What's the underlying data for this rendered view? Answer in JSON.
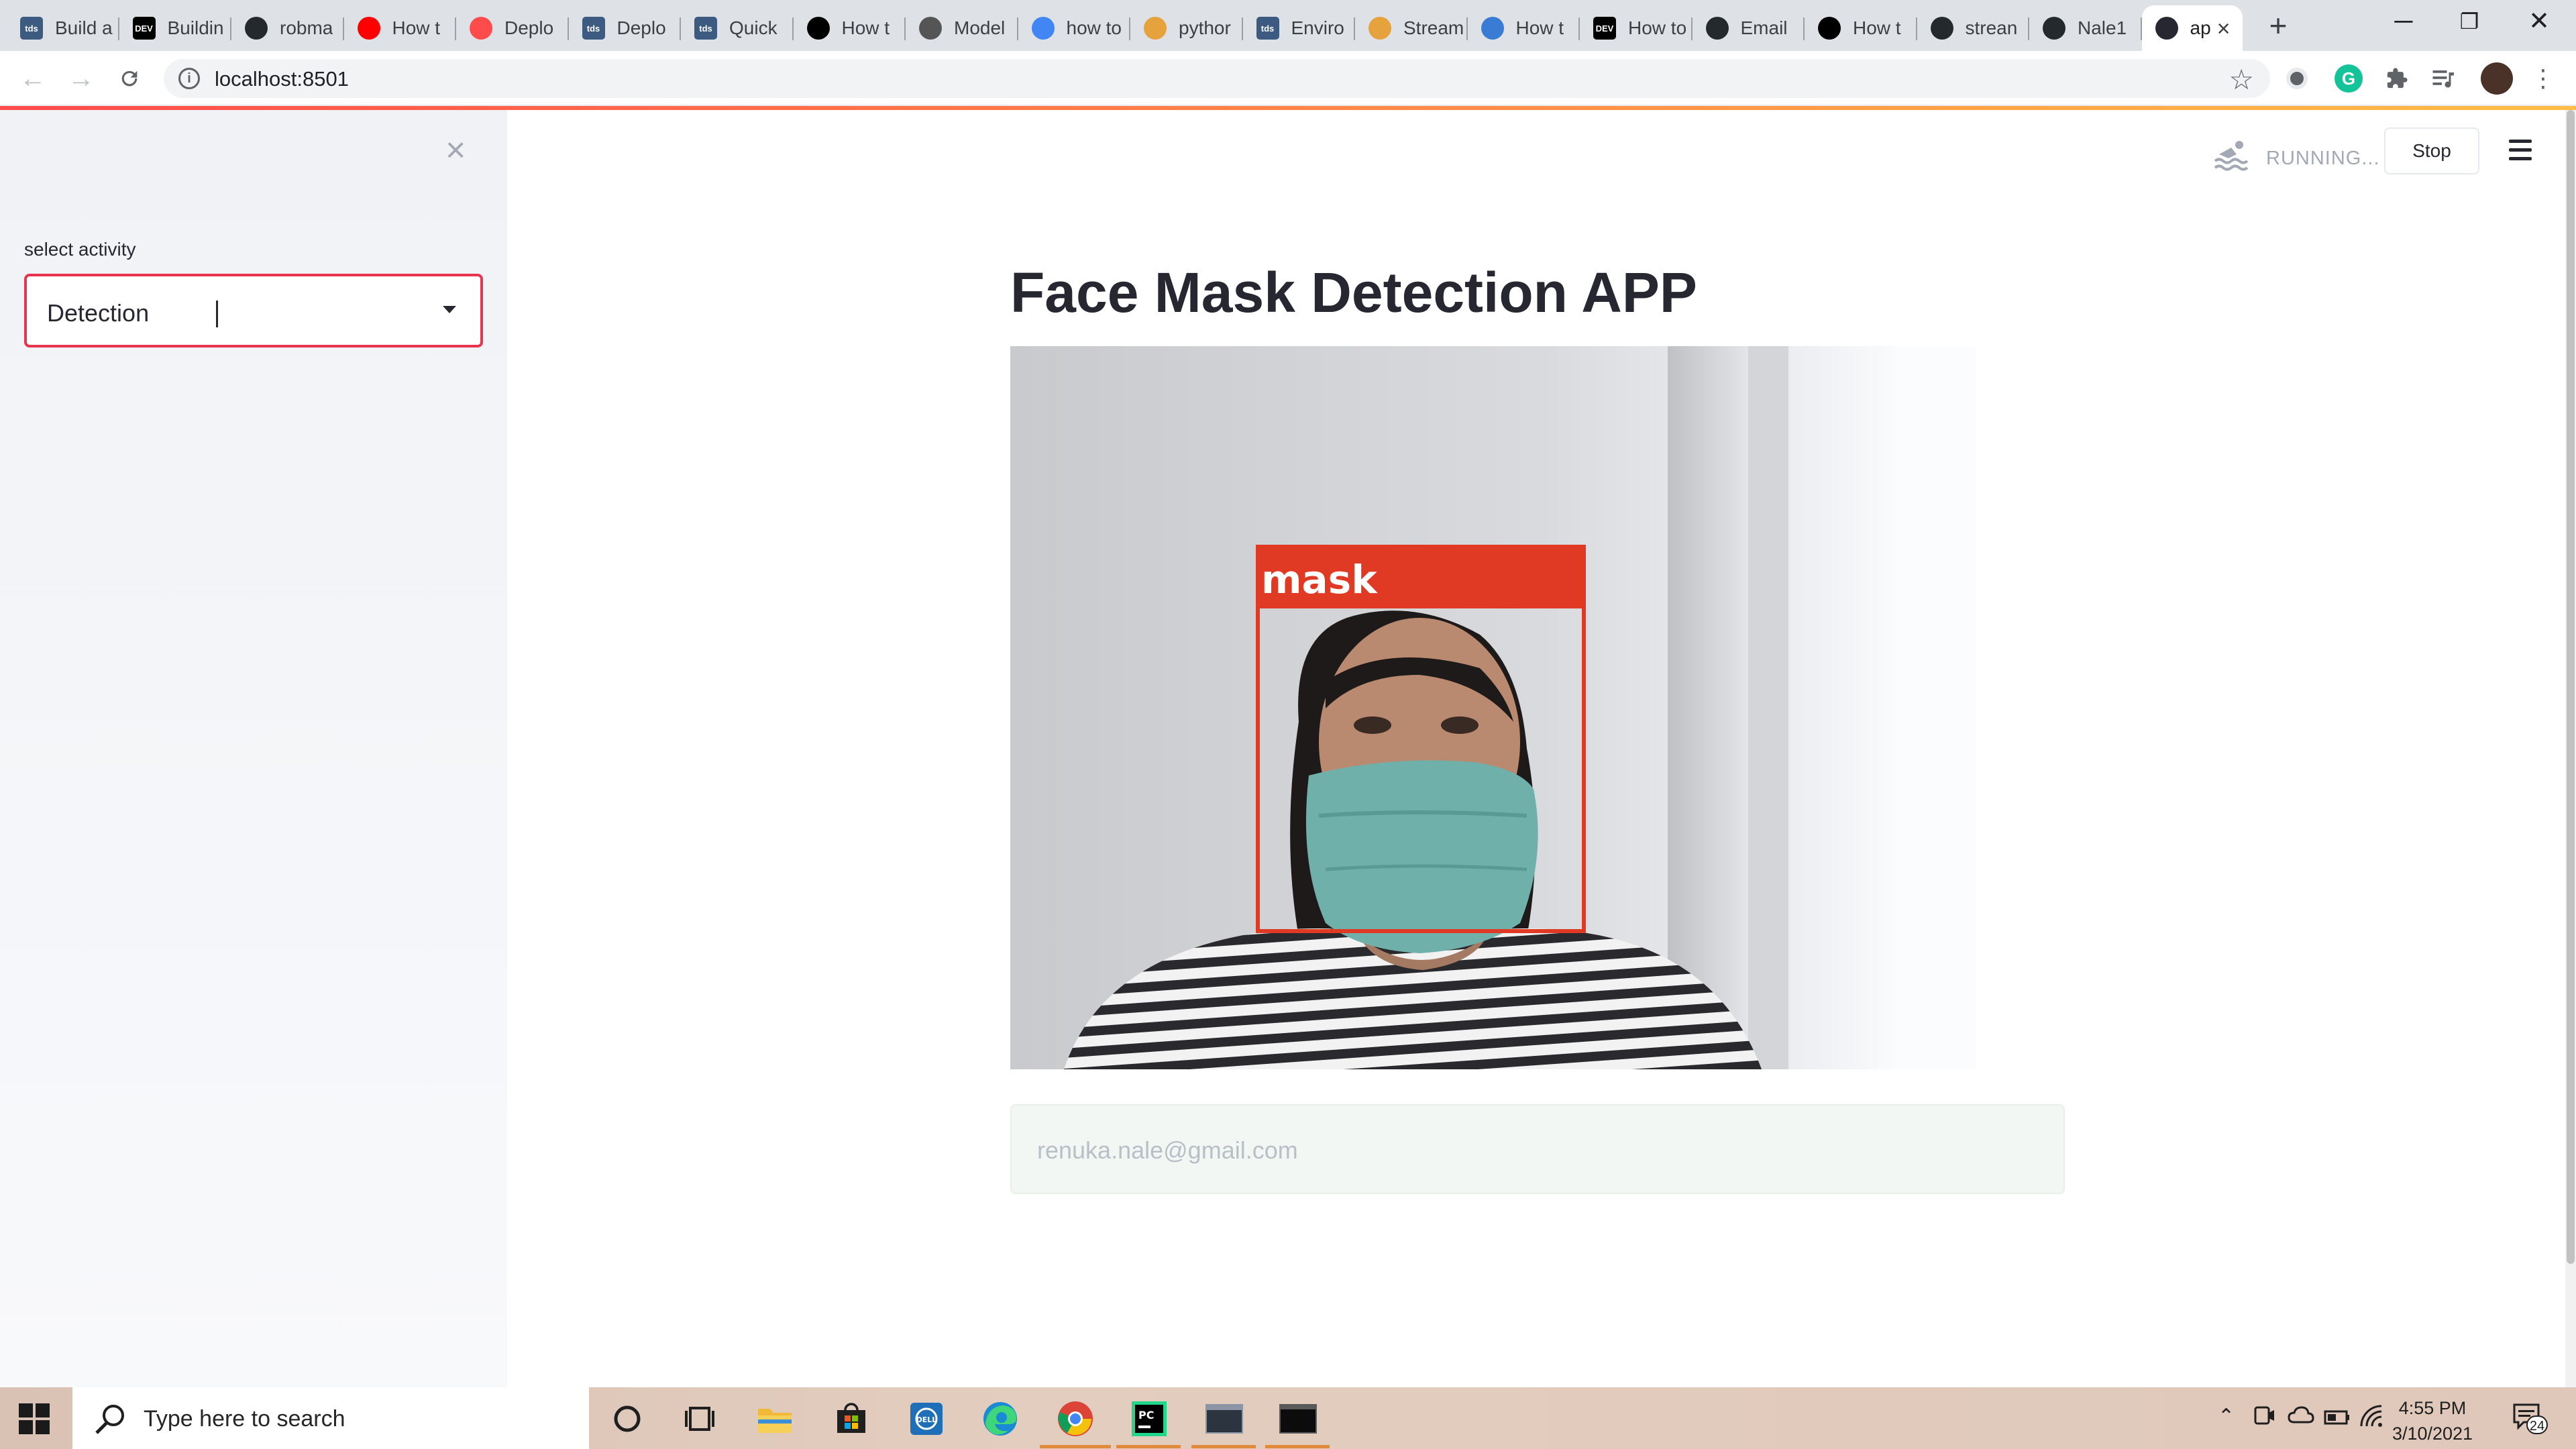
{
  "browser": {
    "tabs": [
      {
        "title": "Build a",
        "favicon": "tds",
        "color": "#3d5a80"
      },
      {
        "title": "Buildin",
        "favicon": "DEV",
        "color": "#000000"
      },
      {
        "title": "robma",
        "favicon": "github-icon",
        "color": "#24292e"
      },
      {
        "title": "How t",
        "favicon": "youtube-icon",
        "color": "#ff0000"
      },
      {
        "title": "Deplo",
        "favicon": "streamlit-icon",
        "color": "#ff4b4b"
      },
      {
        "title": "Deplo",
        "favicon": "tds",
        "color": "#3d5a80"
      },
      {
        "title": "Quick",
        "favicon": "tds",
        "color": "#3d5a80"
      },
      {
        "title": "How t",
        "favicon": "medium-icon",
        "color": "#000000"
      },
      {
        "title": "Model",
        "favicon": "chart-icon",
        "color": "#555555"
      },
      {
        "title": "how to",
        "favicon": "google-icon",
        "color": "#4285f4"
      },
      {
        "title": "pythor",
        "favicon": "pypi-icon",
        "color": "#e6a23c"
      },
      {
        "title": "Enviro",
        "favicon": "tds",
        "color": "#3d5a80"
      },
      {
        "title": "Stream",
        "favicon": "pypi-icon",
        "color": "#e6a23c"
      },
      {
        "title": "How t",
        "favicon": "gear-icon",
        "color": "#3a7bd5"
      },
      {
        "title": "How to",
        "favicon": "DEV",
        "color": "#000000"
      },
      {
        "title": "Email",
        "favicon": "github-icon",
        "color": "#24292e"
      },
      {
        "title": "How t",
        "favicon": "medium-icon",
        "color": "#000000"
      },
      {
        "title": "strean",
        "favicon": "github-icon",
        "color": "#24292e"
      },
      {
        "title": "Nale1",
        "favicon": "github-icon",
        "color": "#24292e"
      },
      {
        "title": "ap",
        "favicon": "streamlit-icon",
        "color": "#262730",
        "active": true
      }
    ],
    "url": "localhost:8501",
    "new_tab": "+",
    "window_controls": {
      "minimize": "─",
      "restore": "❐",
      "close": "✕"
    }
  },
  "app": {
    "sidebar": {
      "close": "×",
      "select_label": "select activity",
      "select_value": "Detection"
    },
    "status": {
      "running_text": "RUNNING...",
      "stop_label": "Stop"
    },
    "title": "Face Mask Detection APP",
    "detection": {
      "label": "mask",
      "box_color": "#e03a24"
    },
    "email_text": "renuka.nale@gmail.com"
  },
  "taskbar": {
    "search_placeholder": "Type here to search",
    "time": "4:55 PM",
    "date": "3/10/2021",
    "notification_count": "24"
  }
}
